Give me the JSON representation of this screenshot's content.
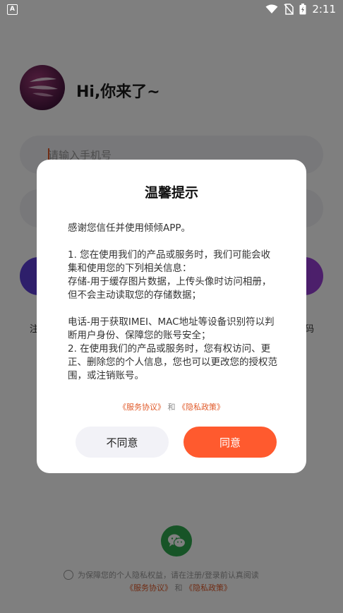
{
  "status": {
    "app_badge": "A",
    "time": "2:11"
  },
  "login": {
    "greeting": "Hi,你来了~",
    "phone_placeholder": "请输入手机号",
    "left_link": "注",
    "right_link": "码",
    "agree_text": "为保障您的个人隐私权益，请在注册/登录前认真阅读",
    "service_link": "《服务协议》",
    "and": "和",
    "privacy_link": "《隐私政策》"
  },
  "dialog": {
    "title": "温馨提示",
    "body": [
      "感谢您信任并使用倾倾APP。",
      "",
      " 1. 您在使用我们的产品或服务时，我们可能会收集和使用您的下列相关信息：",
      " 存储-用于缓存图片数据，上传头像时访问相册，但不会主动读取您的存储数据；",
      "",
      " 电话-用于获取IMEI、MAC地址等设备识别符以判断用户身份、保障您的账号安全；",
      " 2. 在使用我们的产品或服务时，您有权访问、更正、删除您的个人信息，您也可以更改您的授权范围，或注销账号。"
    ],
    "service_link": "《服务协议》",
    "and": "和",
    "privacy_link": "《隐私政策》",
    "disagree_label": "不同意",
    "agree_label": "同意"
  }
}
